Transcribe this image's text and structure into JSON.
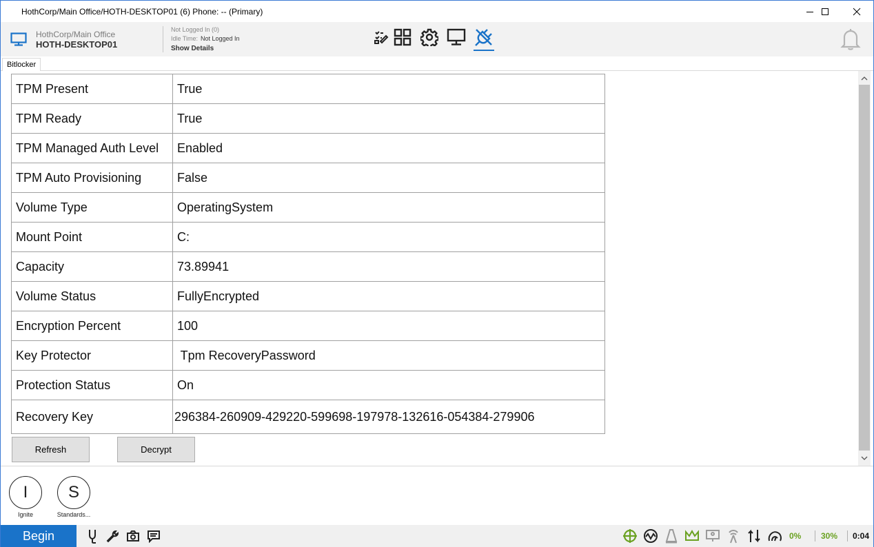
{
  "window": {
    "title": "HothCorp/Main Office/HOTH-DESKTOP01 (6) Phone: -- (Primary)"
  },
  "header": {
    "org": "HothCorp/Main Office",
    "hostname": "HOTH-DESKTOP01",
    "login_status": "Not Logged In (0)",
    "idle_label": "Idle Time:",
    "idle_value": "Not Logged In",
    "show_details": "Show Details",
    "toolbar_icons": [
      "edit-checklist-icon",
      "grid-apps-icon",
      "gear-icon",
      "monitor-icon",
      "plug-disconnect-icon"
    ],
    "active_icon": "plug-disconnect-icon",
    "accent_color": "#1a73c9"
  },
  "tabs": [
    {
      "label": "Bitlocker",
      "selected": true
    }
  ],
  "bitlocker": {
    "rows": [
      {
        "key": "TPM Present",
        "value": "True"
      },
      {
        "key": "TPM Ready",
        "value": "True"
      },
      {
        "key": "TPM Managed Auth Level",
        "value": "Enabled"
      },
      {
        "key": "TPM Auto Provisioning",
        "value": "False"
      },
      {
        "key": "Volume Type",
        "value": "OperatingSystem"
      },
      {
        "key": "Mount Point",
        "value": "C:"
      },
      {
        "key": "Capacity",
        "value": "73.89941"
      },
      {
        "key": "Volume Status",
        "value": "FullyEncrypted"
      },
      {
        "key": "Encryption Percent",
        "value": "100"
      },
      {
        "key": "Key Protector",
        "value": " Tpm RecoveryPassword"
      },
      {
        "key": "Protection Status",
        "value": "On"
      },
      {
        "key": "Recovery Key",
        "value": "296384-260909-429220-599698-197978-132616-054384-279906"
      }
    ],
    "refresh_label": "Refresh",
    "decrypt_label": "Decrypt"
  },
  "shortcuts": [
    {
      "letter": "I",
      "label": "Ignite"
    },
    {
      "letter": "S",
      "label": "Standards..."
    }
  ],
  "taskbar": {
    "begin_label": "Begin",
    "left_icons": [
      "stethoscope-icon",
      "wrench-icon",
      "camera-icon",
      "chat-icon"
    ],
    "right_icons": [
      "crosshair-icon",
      "pulse-icon",
      "cone-icon",
      "crown-icon",
      "presentation-icon",
      "antenna-icon",
      "sync-arrows-icon",
      "gauge-icon"
    ],
    "cpu_percent": "0%",
    "mem_percent": "30%",
    "time": "0:04",
    "status_color": "#6aa121"
  }
}
